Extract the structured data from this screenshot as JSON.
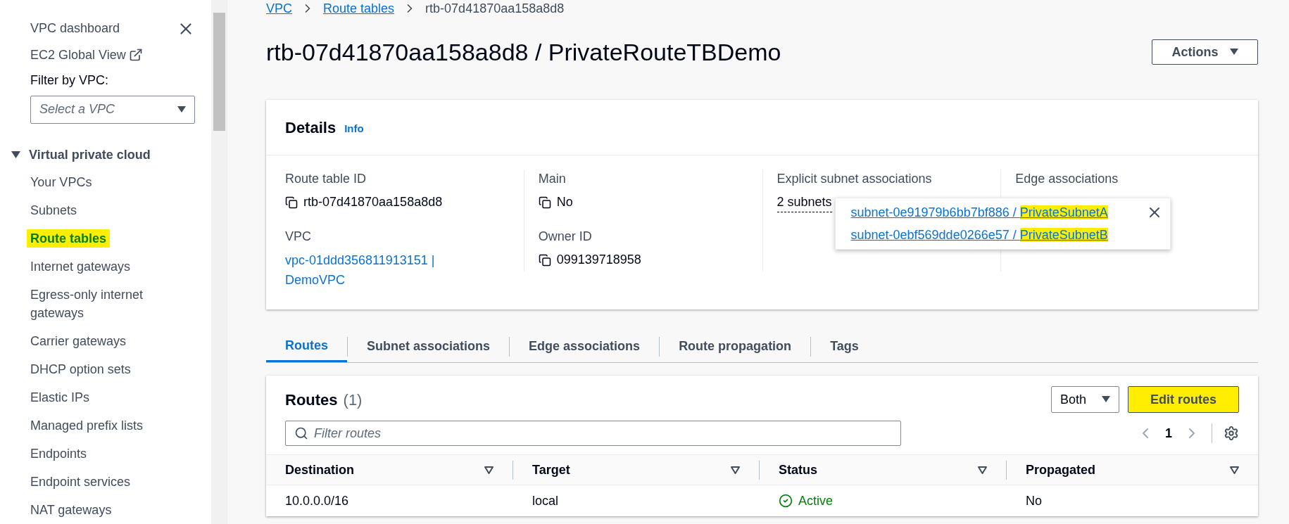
{
  "sidebar": {
    "top_links": [
      {
        "label": "VPC dashboard",
        "kind": "plain"
      },
      {
        "label": "EC2 Global View",
        "kind": "external"
      }
    ],
    "filter": {
      "label": "Filter by VPC:",
      "placeholder": "Select a VPC"
    },
    "section": {
      "label": "Virtual private cloud",
      "expanded": true,
      "items": [
        {
          "label": "Your VPCs",
          "selected": false
        },
        {
          "label": "Subnets",
          "selected": false
        },
        {
          "label": "Route tables",
          "selected": true
        },
        {
          "label": "Internet gateways",
          "selected": false
        },
        {
          "label": "Egress-only internet gateways",
          "selected": false
        },
        {
          "label": "Carrier gateways",
          "selected": false
        },
        {
          "label": "DHCP option sets",
          "selected": false
        },
        {
          "label": "Elastic IPs",
          "selected": false
        },
        {
          "label": "Managed prefix lists",
          "selected": false
        },
        {
          "label": "Endpoints",
          "selected": false
        },
        {
          "label": "Endpoint services",
          "selected": false
        },
        {
          "label": "NAT gateways",
          "selected": false
        }
      ]
    }
  },
  "breadcrumb": [
    {
      "label": "VPC",
      "kind": "link"
    },
    {
      "label": "Route tables",
      "kind": "link"
    },
    {
      "label": "rtb-07d41870aa158a8d8",
      "kind": "current"
    }
  ],
  "title": "rtb-07d41870aa158a8d8 / PrivateRouteTBDemo",
  "actions_button": "Actions",
  "details": {
    "title": "Details",
    "info": "Info",
    "columns": [
      [
        {
          "label": "Route table ID",
          "value": "rtb-07d41870aa158a8d8",
          "kind": "copy"
        },
        {
          "label": "VPC",
          "value": "vpc-01ddd356811913151 | DemoVPC",
          "kind": "link"
        }
      ],
      [
        {
          "label": "Main",
          "value": "No",
          "kind": "copy"
        },
        {
          "label": "Owner ID",
          "value": "099139718958",
          "kind": "copy"
        }
      ],
      [
        {
          "label": "Explicit subnet associations",
          "value": "2 subnets",
          "kind": "popover"
        }
      ],
      [
        {
          "label": "Edge associations",
          "kind": "empty"
        }
      ]
    ],
    "popover": [
      {
        "id": "subnet-0e91979b6bb7bf886 / ",
        "name": "PrivateSubnetA",
        "highlighted": true
      },
      {
        "id": "subnet-0ebf569dde0266e57 / ",
        "name": "PrivateSubnetB",
        "highlighted": true
      }
    ]
  },
  "tabs": [
    {
      "label": "Routes",
      "selected": true
    },
    {
      "label": "Subnet associations",
      "selected": false
    },
    {
      "label": "Edge associations",
      "selected": false
    },
    {
      "label": "Route propagation",
      "selected": false
    },
    {
      "label": "Tags",
      "selected": false
    }
  ],
  "routes": {
    "title": "Routes",
    "count": "(1)",
    "filter_select": "Both",
    "edit_button": {
      "label": "Edit routes",
      "highlighted": true
    },
    "search_placeholder": "Filter routes",
    "page": "1",
    "columns": [
      "Destination",
      "Target",
      "Status",
      "Propagated"
    ],
    "rows": [
      {
        "destination": "10.0.0.0/16",
        "target": "local",
        "status": "Active",
        "kind": "success",
        "propagated": "No"
      }
    ]
  }
}
